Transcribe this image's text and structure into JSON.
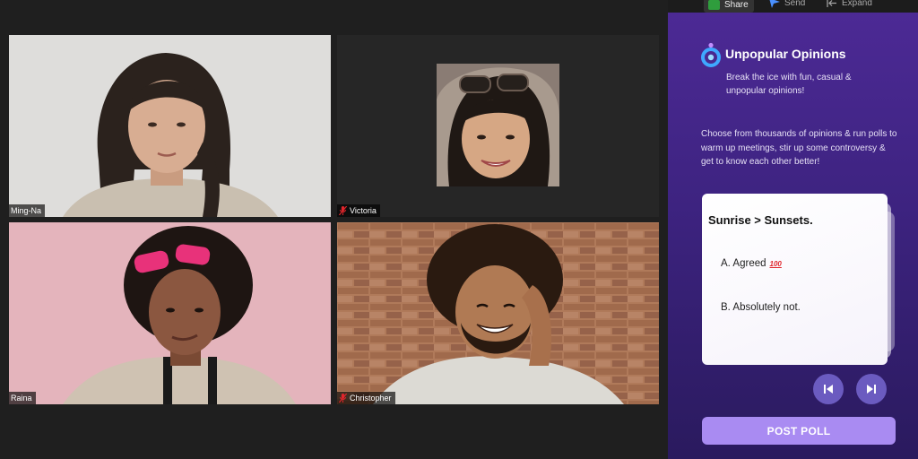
{
  "participants": [
    {
      "name": "Ming-Na",
      "muted": false,
      "bg": "#dcdcda"
    },
    {
      "name": "Victoria",
      "muted": true,
      "bg": "#262626"
    },
    {
      "name": "Raina",
      "muted": false,
      "bg": "#e3b2ba"
    },
    {
      "name": "Christopher",
      "muted": true,
      "bg": "#9a6a4c"
    }
  ],
  "toolbar": {
    "share_label": "Share",
    "send_label": "Send",
    "expand_label": "Expand"
  },
  "app": {
    "title": "Unpopular Opinions",
    "subtitle": "Break the ice with fun, casual & unpopular opinions!",
    "description": "Choose from thousands of opinions & run polls to warm up meetings, stir up some controversy & get to know each other better!"
  },
  "poll": {
    "question": "Sunrise > Sunsets.",
    "options": [
      "A. Agreed",
      "B. Absolutely not."
    ],
    "option_a_emoji": "100"
  },
  "post_button_label": "POST POLL",
  "colors": {
    "panel_top": "#4d2a96",
    "panel_bottom": "#2a1a5e",
    "post_button": "#a98bf2",
    "nav_button": "#6b5bc0",
    "mic_off": "#e0252b",
    "share_green": "#2f9d3d"
  }
}
